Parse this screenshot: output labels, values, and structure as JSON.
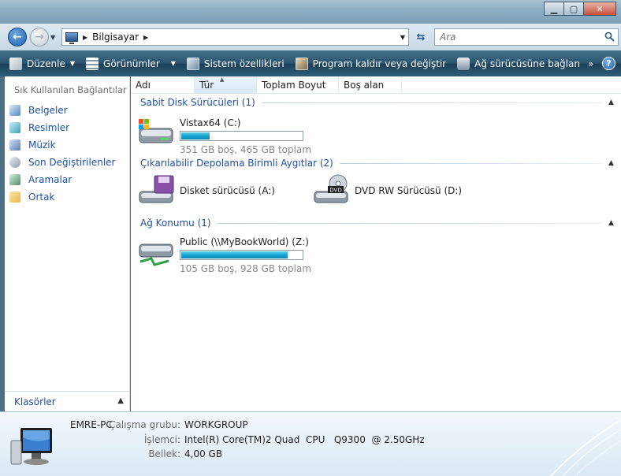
{
  "window": {
    "minimize_glyph": "▁",
    "maximize_glyph": "▢",
    "close_glyph": "✕"
  },
  "address": {
    "breadcrumb": [
      "Bilgisayar"
    ],
    "search_placeholder": "Ara"
  },
  "toolbar": {
    "items": [
      {
        "label": "Düzenle",
        "has_menu": true,
        "icon": "organize-icon"
      },
      {
        "label": "Görünümler",
        "has_menu": true,
        "icon": "views-icon"
      },
      {
        "label": "Sistem özellikleri",
        "has_menu": false,
        "icon": "system-properties-icon"
      },
      {
        "label": "Program kaldır veya değiştir",
        "has_menu": false,
        "icon": "uninstall-icon"
      },
      {
        "label": "Ağ sürücüsüne bağlan",
        "has_menu": false,
        "icon": "map-network-drive-icon"
      }
    ],
    "more_glyph": "»",
    "help_glyph": "?"
  },
  "sidebar": {
    "header": "Sık Kullanılan Bağlantılar",
    "items": [
      {
        "label": "Belgeler",
        "icon": "documents-icon",
        "color": "#4f86c6"
      },
      {
        "label": "Resimler",
        "icon": "pictures-icon",
        "color": "#3aa0b8"
      },
      {
        "label": "Müzik",
        "icon": "music-icon",
        "color": "#5f7fb6"
      },
      {
        "label": "Son Değiştirilenler",
        "icon": "recent-icon",
        "color": "#8a9aad"
      },
      {
        "label": "Aramalar",
        "icon": "searches-icon",
        "color": "#4f8e6a"
      },
      {
        "label": "Ortak",
        "icon": "public-folder-icon",
        "color": "#e8b64a"
      }
    ],
    "folders_label": "Klasörler"
  },
  "columns": [
    "Adı",
    "Tür",
    "Toplam Boyut",
    "Boş alan"
  ],
  "groups": [
    {
      "title": "Sabit Disk Sürücüleri (1)",
      "drives": [
        {
          "name": "Vistax64 (C:)",
          "info": "351 GB boş, 465 GB toplam",
          "used_fraction": 0.245,
          "icon": "hard-drive-icon"
        }
      ]
    },
    {
      "title": "Çıkarılabilir Depolama Birimli Aygıtlar (2)",
      "drives": [
        {
          "name": "Disket sürücüsü (A:)",
          "icon": "floppy-drive-icon"
        },
        {
          "name": "DVD RW Sürücüsü (D:)",
          "icon": "dvd-drive-icon",
          "badge": "DVD"
        }
      ]
    },
    {
      "title": "Ağ Konumu (1)",
      "drives": [
        {
          "name": "Public (\\\\MyBookWorld) (Z:)",
          "info": "105 GB boş, 928 GB toplam",
          "used_fraction": 0.887,
          "icon": "network-drive-icon"
        }
      ]
    }
  ],
  "details": {
    "computer_name": "EMRE-PC",
    "rows": [
      {
        "label": "Çalışma grubu:",
        "value": "WORKGROUP"
      },
      {
        "label": "İşlemci:",
        "value": "Intel(R) Core(TM)2 Quad  CPU   Q9300  @ 2.50GHz"
      },
      {
        "label": "Bellek:",
        "value": "4,00 GB"
      }
    ]
  },
  "colors": {
    "accent_link": "#1f4fa3",
    "bar_fill": "#19a3d1",
    "toolbar_bg": "#2b556e"
  }
}
